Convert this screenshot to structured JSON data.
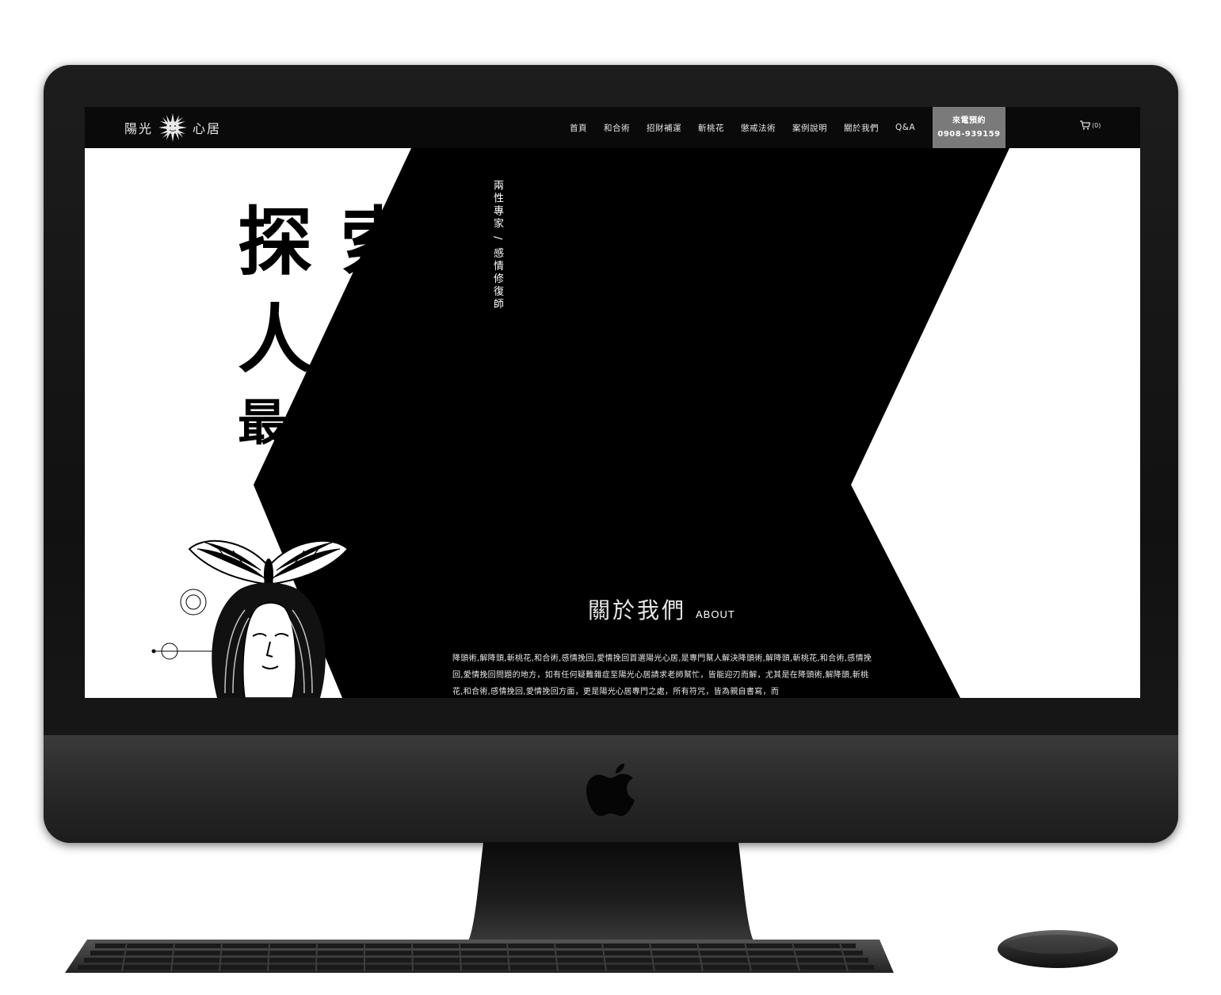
{
  "site": {
    "logo_left": "陽光",
    "logo_right": "心居"
  },
  "nav": {
    "items": [
      "首頁",
      "和合術",
      "招財補運",
      "斬桃花",
      "懲戒法術",
      "案例說明",
      "關於我們",
      "Q&A"
    ]
  },
  "booking": {
    "label": "來電預約",
    "phone": "0908-939159"
  },
  "cart": {
    "count": "(0)"
  },
  "hero": {
    "line1": "探索",
    "line2": "人性",
    "line3": "最深處",
    "tagline": "兩性專家 / 感情修復師"
  },
  "about": {
    "title": "關於我們",
    "subtitle": "ABOUT",
    "text": "降頭術,解降頭,斬桃花,和合術,感情挽回,愛情挽回首選陽光心居,是專門幫人解決降頭術,解降頭,斬桃花,和合術,感情挽回,愛情挽回問題的地方，如有任何疑難雜症至陽光心居請求老師幫忙，皆能迎刃而解，尤其是在降頭術,解降頭,斬桃花,和合術,感情挽回,愛情挽回方面，更是陽光心居專門之處，所有符咒，皆為親自書寫，而"
  },
  "colors": {
    "screen_bg": "#000000",
    "hero_white": "#ffffff",
    "booking_bg": "#7a7a7a"
  },
  "icons": [
    "sun-logo-icon",
    "cart-icon",
    "apple-logo-icon"
  ]
}
